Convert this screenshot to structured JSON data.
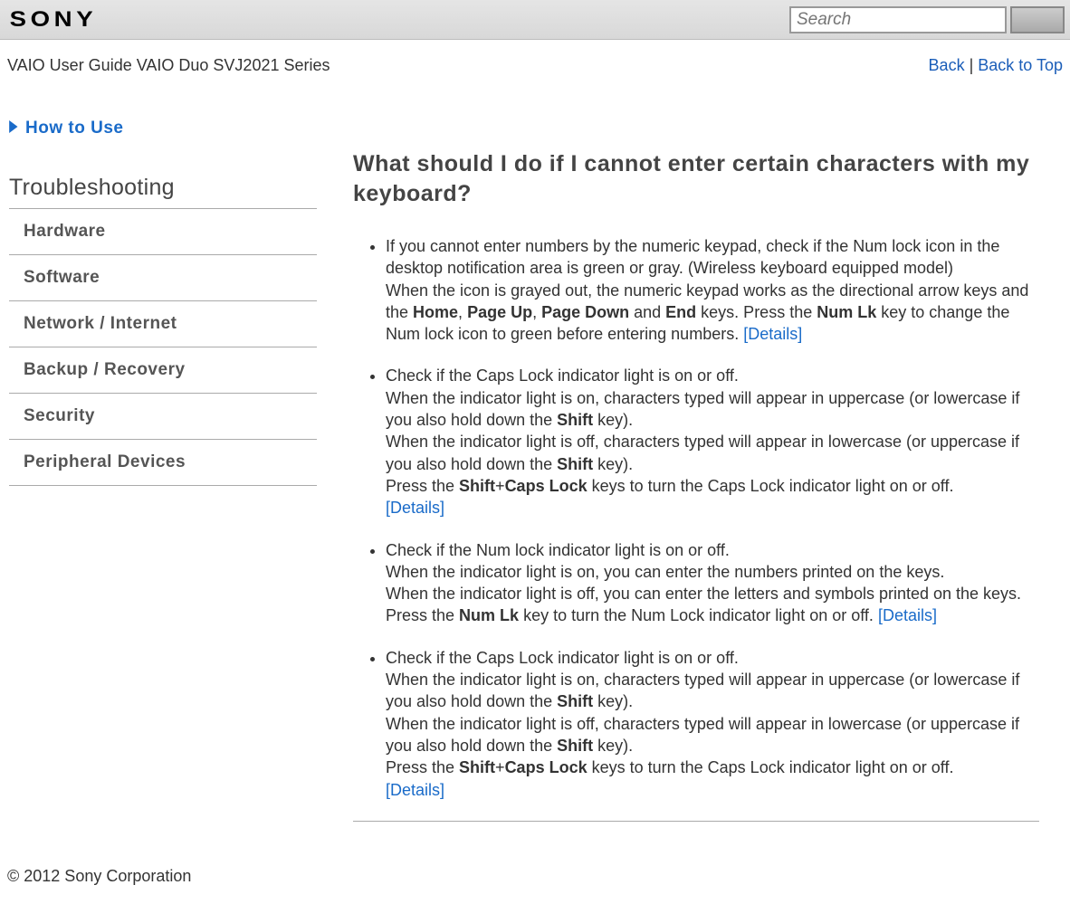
{
  "header": {
    "brand": "SONY",
    "search_placeholder": "Search"
  },
  "subheader": {
    "title": "VAIO User Guide VAIO Duo SVJ2021 Series",
    "back": "Back",
    "separator": " | ",
    "back_to_top": "Back to Top"
  },
  "sidebar": {
    "how_to_use": "How to Use",
    "troubleshooting": "Troubleshooting",
    "items": [
      {
        "label": "Hardware"
      },
      {
        "label": "Software"
      },
      {
        "label": "Network / Internet"
      },
      {
        "label": "Backup / Recovery"
      },
      {
        "label": "Security"
      },
      {
        "label": "Peripheral Devices"
      }
    ]
  },
  "article": {
    "title": "What should I do if I cannot enter certain characters with my keyboard?",
    "details_label": "[Details]",
    "bullets": {
      "b0": {
        "s0": "If you cannot enter numbers by the numeric keypad, check if the Num lock icon in the desktop notification area is green or gray. (Wireless keyboard equipped model)",
        "s1a": "When the icon is grayed out, the numeric keypad works as the directional arrow keys and the ",
        "k0": "Home",
        "c0": ", ",
        "k1": "Page Up",
        "c1": ", ",
        "k2": "Page Down",
        "c2": " and ",
        "k3": "End",
        "c3": " keys. Press the ",
        "k4": "Num Lk",
        "c4": " key to change the Num lock icon to green before entering numbers. "
      },
      "b1": {
        "s0": "Check if the Caps Lock indicator light is on or off.",
        "s1a": "When the indicator light is on, characters typed will appear in uppercase (or lowercase if you also hold down the ",
        "k0": "Shift",
        "s1b": " key).",
        "s2a": "When the indicator light is off, characters typed will appear in lowercase (or uppercase if you also hold down the ",
        "k1": "Shift",
        "s2b": " key).",
        "s3a": "Press the ",
        "k2": "Shift",
        "plus": "+",
        "k3": "Caps Lock",
        "s3b": " keys to turn the Caps Lock indicator light on or off. "
      },
      "b2": {
        "s0": "Check if the Num lock indicator light is on or off.",
        "s1": "When the indicator light is on, you can enter the numbers printed on the keys.",
        "s2": "When the indicator light is off, you can enter the letters and symbols printed on the keys.",
        "s3a": "Press the ",
        "k0": "Num Lk",
        "s3b": " key to turn the Num Lock indicator light on or off. "
      },
      "b3": {
        "s0": "Check if the Caps Lock indicator light is on or off.",
        "s1a": "When the indicator light is on, characters typed will appear in uppercase (or lowercase if you also hold down the ",
        "k0": "Shift",
        "s1b": " key).",
        "s2a": "When the indicator light is off, characters typed will appear in lowercase (or uppercase if you also hold down the ",
        "k1": "Shift",
        "s2b": " key).",
        "s3a": "Press the ",
        "k2": "Shift",
        "plus": "+",
        "k3": "Caps Lock",
        "s3b": " keys to turn the Caps Lock indicator light on or off. "
      }
    }
  },
  "footer": {
    "copyright": "© 2012 Sony Corporation"
  }
}
